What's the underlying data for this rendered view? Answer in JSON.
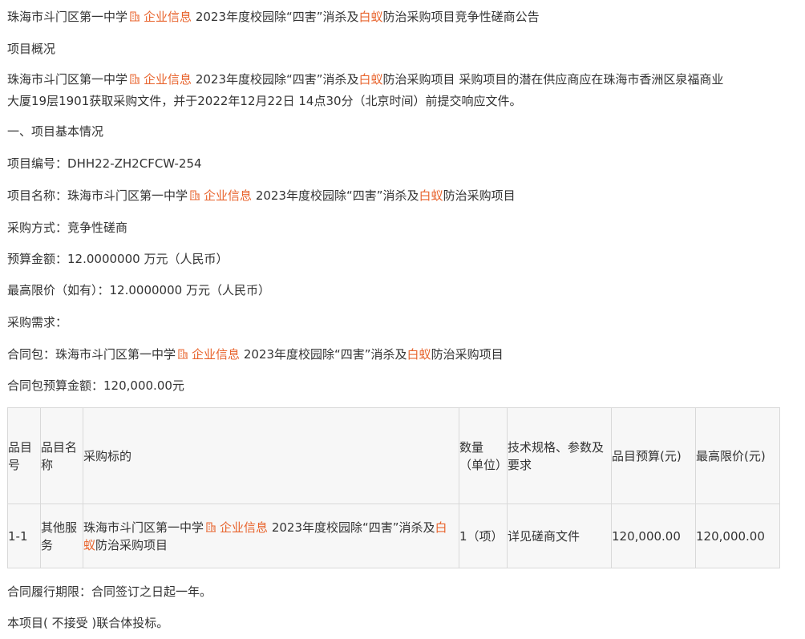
{
  "school": "珠海市斗门区第一中学",
  "company_info": "企业信息",
  "project_part1": "2023年度校园除“四害”消杀及",
  "termite": "白蚁",
  "project_part2": "防治采购项目",
  "title_suffix": "竞争性磋商公告",
  "overview_heading": "项目概况",
  "overview_after": " 采购项目的潜在供应商应在珠海市香洲区泉福商业",
  "overview_line2": "大厦19层1901获取采购文件，并于2022年12月22日 14点30分（北京时间）前提交响应文件。",
  "section1_heading": "一、项目基本情况",
  "project_no_label": "项目编号：",
  "project_no": "DHH22-ZH2CFCW-254",
  "project_name_label": "项目名称：",
  "method_label": "采购方式：",
  "method": "竞争性磋商",
  "budget_label": "预算金额：",
  "budget": "12.0000000 万元（人民币）",
  "max_price_label": "最高限价（如有）：",
  "max_price": "12.0000000 万元（人民币）",
  "demand_label": "采购需求：",
  "package_label": "合同包：",
  "package_budget_label": "合同包预算金额：",
  "package_budget": "120,000.00元",
  "table": {
    "headers": {
      "item_no": "品目号",
      "item_name": "品目名称",
      "subject": "采购标的",
      "qty": "数量（单位）",
      "spec": "技术规格、参数及要求",
      "item_budget": "品目预算(元)",
      "max_price": "最高限价(元)"
    },
    "row": {
      "item_no": "1-1",
      "item_name": "其他服务",
      "qty": "1（项）",
      "spec": "详见磋商文件",
      "item_budget": "120,000.00",
      "max_price": "120,000.00"
    }
  },
  "contract_period_label": "合同履行期限：",
  "contract_period": "合同签订之日起一年。",
  "consortium": "本项目( 不接受 )联合体投标。",
  "colors": {
    "highlight": "#e8632c",
    "text": "#333333",
    "border": "#d9d9d9",
    "table_bg": "#f7f7f7"
  },
  "icons": {
    "company": "building-icon"
  }
}
